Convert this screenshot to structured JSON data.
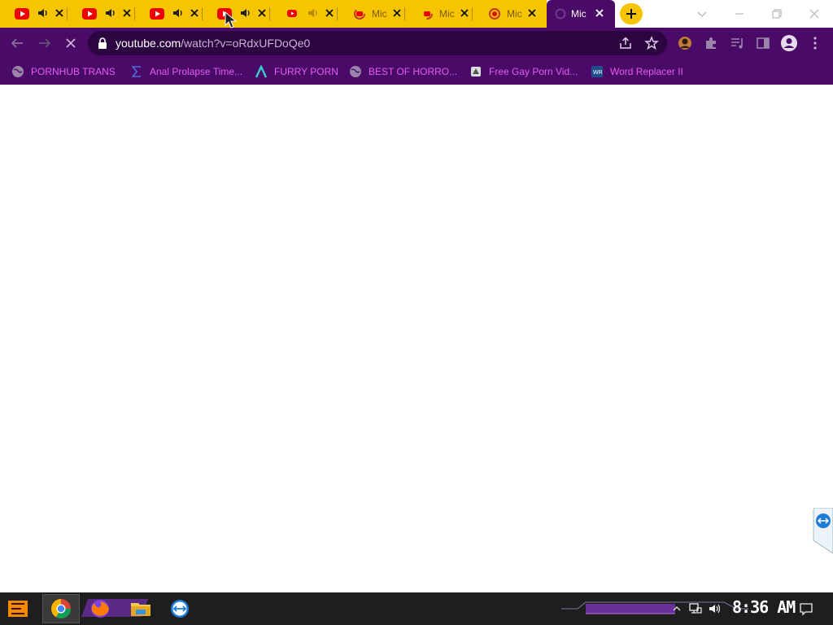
{
  "tabs": [
    {
      "title": "",
      "favicon": "youtube-icon",
      "audio": true
    },
    {
      "title": "",
      "favicon": "youtube-icon",
      "audio": true
    },
    {
      "title": "",
      "favicon": "youtube-icon",
      "audio": true
    },
    {
      "title": "",
      "favicon": "youtube-icon",
      "audio": true
    },
    {
      "title": "",
      "favicon": "youtube-small-icon",
      "audio": true
    },
    {
      "title": "Mic",
      "favicon": "youtube-loading-icon",
      "audio": false
    },
    {
      "title": "Mic",
      "favicon": "youtube-loading-icon",
      "audio": false
    },
    {
      "title": "Mic",
      "favicon": "youtube-loading-icon",
      "audio": false
    },
    {
      "title": "Mic",
      "favicon": "loading-icon",
      "audio": false,
      "active": true
    }
  ],
  "address": {
    "host": "youtube.com",
    "path": "/watch?v=oRdxUFDoQe0"
  },
  "bookmarks": [
    {
      "label": "PORNHUB TRANS",
      "icon": "globe-icon"
    },
    {
      "label": "Anal Prolapse Time...",
      "icon": "sigma-icon"
    },
    {
      "label": "FURRY PORN",
      "icon": "caret-logo-icon"
    },
    {
      "label": "BEST OF HORRO...",
      "icon": "globe-icon"
    },
    {
      "label": "Free Gay Porn Vid...",
      "icon": "site-icon"
    },
    {
      "label": "Word Replacer II",
      "icon": "word-replacer-icon"
    }
  ],
  "taskbar": {
    "clock": "8:36 AM"
  },
  "colors": {
    "tab_strip": "#f7c400",
    "toolbar": "#4a0a68",
    "bookmark_text": "#e45cf0",
    "taskbar": "#1e1e1e"
  }
}
